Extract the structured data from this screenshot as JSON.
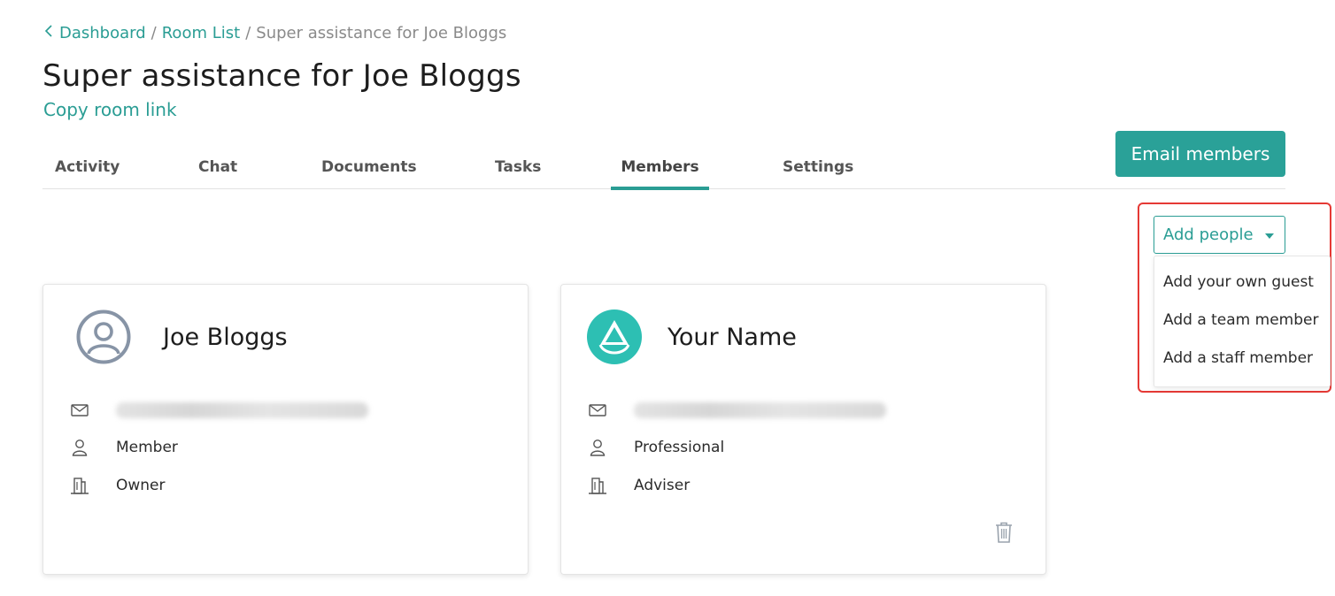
{
  "breadcrumb": {
    "items": [
      "Dashboard",
      "Room List"
    ],
    "current": "Super assistance for Joe Bloggs",
    "separator": "/"
  },
  "page": {
    "title": "Super assistance for Joe Bloggs",
    "copy_link_label": "Copy room link"
  },
  "tabs": [
    {
      "label": "Activity",
      "active": false
    },
    {
      "label": "Chat",
      "active": false
    },
    {
      "label": "Documents",
      "active": false
    },
    {
      "label": "Tasks",
      "active": false
    },
    {
      "label": "Members",
      "active": true
    },
    {
      "label": "Settings",
      "active": false
    }
  ],
  "actions": {
    "email_members_label": "Email members",
    "add_people_label": "Add people"
  },
  "dropdown": {
    "items": [
      "Add your own guest",
      "Add a team member",
      "Add a staff member"
    ]
  },
  "members": [
    {
      "name": "Joe Bloggs",
      "avatar": "user-circle-icon",
      "email_obscured": true,
      "role": "Member",
      "relationship": "Owner"
    },
    {
      "name": "Your Name",
      "avatar": "brand-logo",
      "email_obscured": true,
      "role": "Professional",
      "relationship": "Adviser"
    }
  ],
  "colors": {
    "accent": "#2a9d94",
    "button": "#2aa198",
    "highlight": "#e53935"
  }
}
